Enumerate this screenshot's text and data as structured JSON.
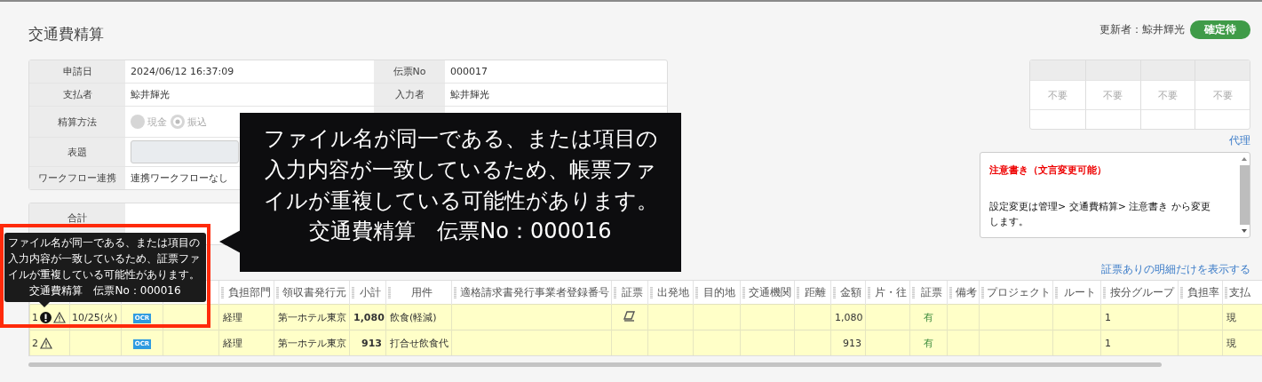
{
  "page_title": "交通費精算",
  "updater": "更新者：鯨井輝光",
  "status_badge": "確定待",
  "info_rows": [
    {
      "kind": "text",
      "label": "申請日",
      "value": "2024/06/12 16:37:09",
      "right_label": "伝票No",
      "right_value": "000017"
    },
    {
      "kind": "text",
      "label": "支払者",
      "value": "鯨井輝光",
      "right_label": "入力者",
      "right_value": "鯨井輝光"
    },
    {
      "kind": "radio",
      "label": "精算方法",
      "disabled": true,
      "options": [
        {
          "label": "現金",
          "selected": false
        },
        {
          "label": "振込",
          "selected": true
        }
      ]
    },
    {
      "kind": "input",
      "label": "表題"
    },
    {
      "kind": "text",
      "label": "ワークフロー連携",
      "value": "連携ワークフローなし"
    }
  ],
  "summary": {
    "label": "合計"
  },
  "approval": {
    "cells": [
      "不要",
      "不要",
      "不要",
      "不要"
    ]
  },
  "proxy_link": "代理",
  "notice": {
    "heading": "注意書き（文言変更可能）",
    "body": "設定変更は管理> 交通費精算> 注意書き から変更します。"
  },
  "filter_link": "証票ありの明細だけを表示する",
  "table": {
    "columns": [
      {
        "kind": "no"
      },
      {
        "kind": "text"
      },
      {
        "kind": "ocr"
      },
      {
        "kind": "text"
      },
      {
        "kind": "text",
        "label": "負担部門"
      },
      {
        "kind": "text",
        "label": "領収書発行元"
      },
      {
        "kind": "bold",
        "label": "小計"
      },
      {
        "kind": "text",
        "label": "用件"
      },
      {
        "kind": "text",
        "label": "適格請求書発行事業者登録番号"
      },
      {
        "kind": "receipt",
        "label": "証票"
      },
      {
        "kind": "text",
        "label": "出発地"
      },
      {
        "kind": "text",
        "label": "目的地"
      },
      {
        "kind": "text",
        "label": "交通機関"
      },
      {
        "kind": "num",
        "label": "距離"
      },
      {
        "kind": "num",
        "label": "金額"
      },
      {
        "kind": "text",
        "label": "片・往"
      },
      {
        "kind": "voucher",
        "label": "証票"
      },
      {
        "kind": "text",
        "label": "備考"
      },
      {
        "kind": "text",
        "label": "プロジェクト"
      },
      {
        "kind": "text",
        "label": "ルート"
      },
      {
        "kind": "text",
        "label": "按分グループ"
      },
      {
        "kind": "text",
        "label": "負担率"
      },
      {
        "kind": "num",
        "label": "支払"
      }
    ],
    "rows": [
      {
        "no": "1",
        "duplicate": true,
        "warning": true,
        "receipt_icon": true,
        "cells": [
          null,
          "10/25(火)",
          "OCR",
          null,
          "経理",
          "第一ホテル東京",
          "1,080",
          "飲食(軽減)",
          null,
          null,
          null,
          null,
          null,
          null,
          "1,080",
          null,
          "有",
          null,
          null,
          null,
          "1",
          null,
          "現"
        ]
      },
      {
        "no": "2",
        "duplicate": false,
        "warning": true,
        "receipt_icon": false,
        "cells": [
          null,
          null,
          "OCR",
          null,
          "経理",
          "第一ホテル東京",
          "913",
          "打合せ飲食代",
          null,
          null,
          null,
          null,
          null,
          null,
          "913",
          null,
          "有",
          null,
          null,
          null,
          "1",
          null,
          "現"
        ]
      }
    ]
  },
  "callout": {
    "message": "ファイル名が同一である、または項目の入力内容が一致しているため、帳票ファイルが重複している可能性があります。",
    "reference": "交通費精算　伝票No：000016"
  },
  "tooltip": {
    "message": "ファイル名が同一である、または項目の入力内容が一致しているため、証票ファイルが重複している可能性があります。",
    "reference": "交通費精算　伝票No：000016"
  }
}
